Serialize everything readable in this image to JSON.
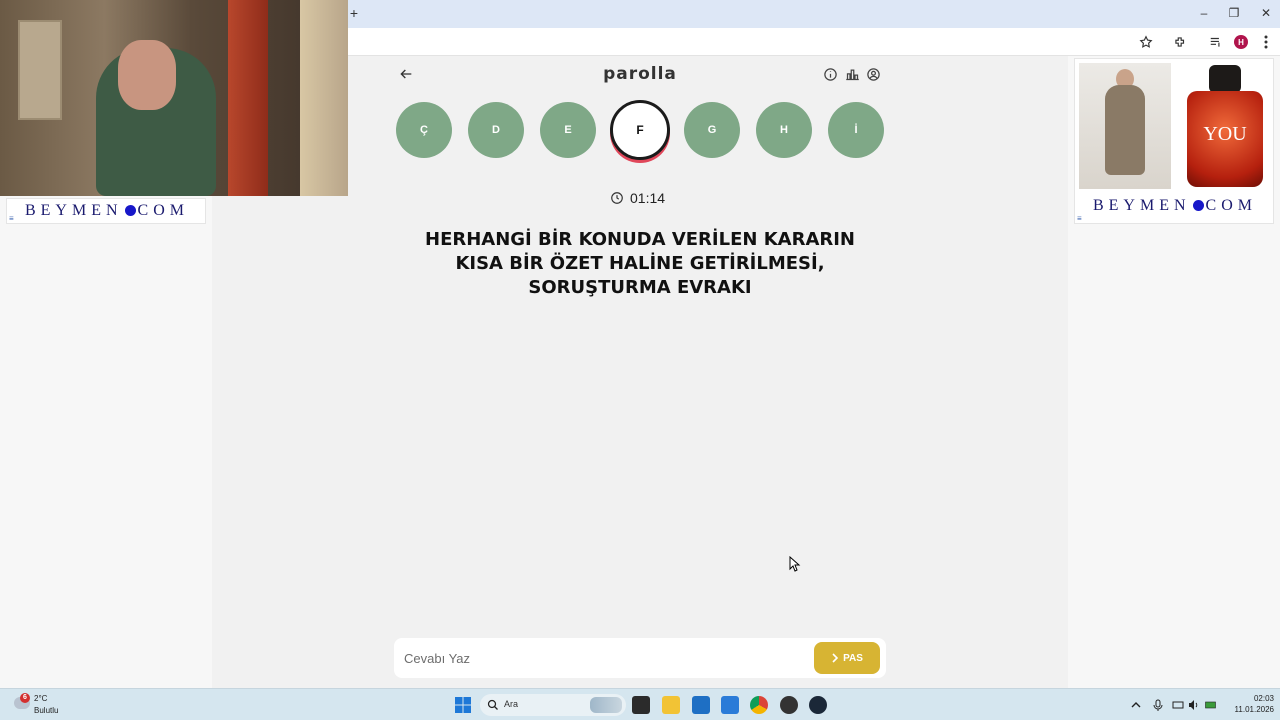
{
  "browser": {
    "new_tab_symbol": "+",
    "window_controls": [
      "–",
      "❐",
      "✕"
    ],
    "profile_initial": "H"
  },
  "ads": {
    "brand_left": "BEYMEN",
    "brand_right": "COM",
    "perfume_text": "YOU"
  },
  "game": {
    "logo": "parolla",
    "letters": [
      "Ç",
      "D",
      "E",
      "F",
      "G",
      "H",
      "İ"
    ],
    "active_letter": "F",
    "timer": "01:14",
    "question": "HERHANGİ BİR KONUDA VERİLEN KARARIN KISA BİR ÖZET HALİNE GETİRİLMESİ, SORUŞTURMA EVRAKI",
    "answer_placeholder": "Cevabı Yaz",
    "pass_label": "PAS"
  },
  "taskbar": {
    "weather_badge": "6",
    "weather_temp": "2°C",
    "weather_desc": "Bulutlu",
    "search_label": "Ara",
    "time": "02:03",
    "date": "11.01.2026"
  },
  "colors": {
    "letter_default": "#7fa887",
    "active_ring_shadow": "#e0475a",
    "pass_button": "#d7b433",
    "brand_blue": "#1a1a6e"
  }
}
